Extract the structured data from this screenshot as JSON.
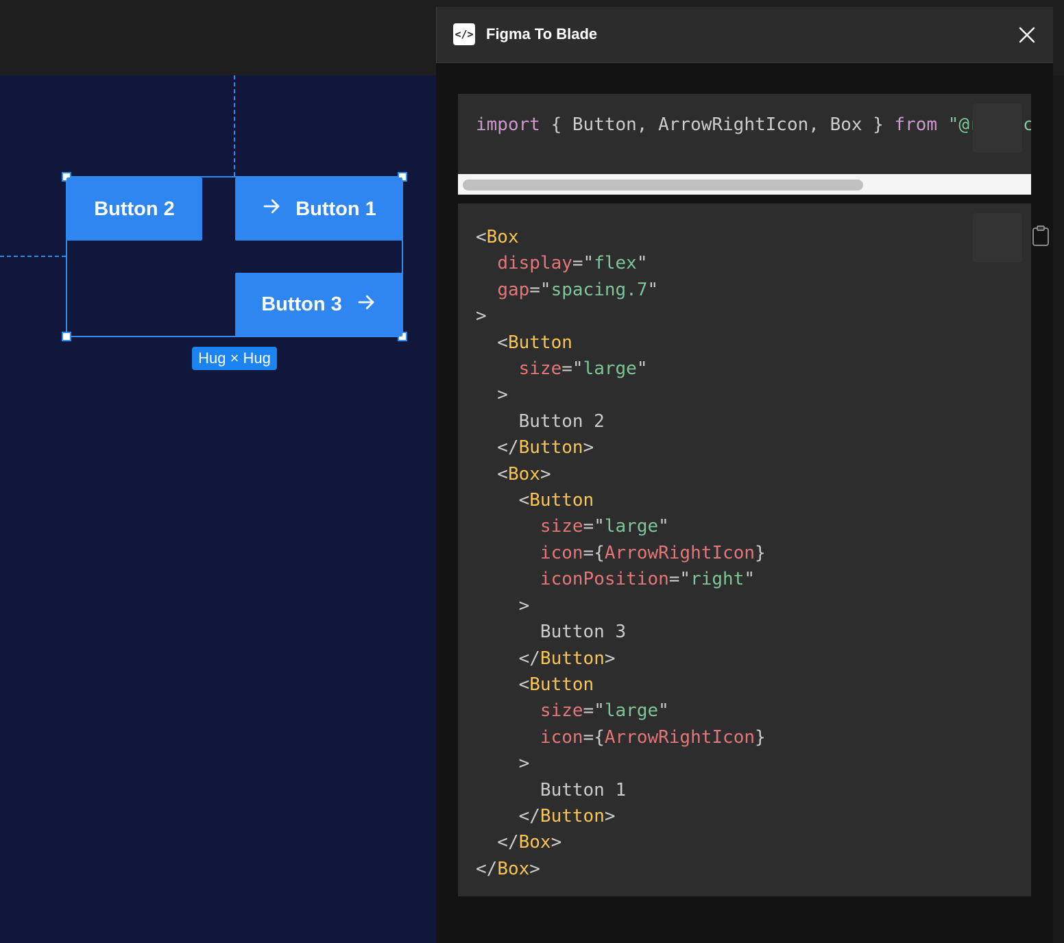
{
  "canvas": {
    "buttons": {
      "button2": {
        "label": "Button 2"
      },
      "button1": {
        "label": "Button 1",
        "icon": "arrow-right-icon"
      },
      "button3": {
        "label": "Button 3",
        "icon": "arrow-right-icon"
      }
    },
    "size_badge": "Hug × Hug",
    "accent_color": "#2f86f0",
    "selection_color": "#2a8df0"
  },
  "plugin": {
    "title": "Figma To Blade",
    "icon": "code-brackets-icon",
    "close_icon": "close-icon"
  },
  "import_code": {
    "kw_import": "import",
    "names": "{ Button, ArrowRightIcon, Box }",
    "kw_from": "from",
    "source": "\"@r",
    "trailing": "c"
  },
  "jsx_code": {
    "lines": [
      [
        {
          "t": "pun",
          "v": "<"
        },
        {
          "t": "tag",
          "v": "Box"
        }
      ],
      [
        {
          "t": "pun",
          "v": "  "
        },
        {
          "t": "attr",
          "v": "display"
        },
        {
          "t": "pun",
          "v": "=\""
        },
        {
          "t": "str",
          "v": "flex"
        },
        {
          "t": "pun",
          "v": "\""
        }
      ],
      [
        {
          "t": "pun",
          "v": "  "
        },
        {
          "t": "attr",
          "v": "gap"
        },
        {
          "t": "pun",
          "v": "=\""
        },
        {
          "t": "str",
          "v": "spacing.7"
        },
        {
          "t": "pun",
          "v": "\""
        }
      ],
      [
        {
          "t": "pun",
          "v": ">"
        }
      ],
      [
        {
          "t": "pun",
          "v": "  <"
        },
        {
          "t": "tag",
          "v": "Button"
        }
      ],
      [
        {
          "t": "pun",
          "v": "    "
        },
        {
          "t": "attr",
          "v": "size"
        },
        {
          "t": "pun",
          "v": "=\""
        },
        {
          "t": "str",
          "v": "large"
        },
        {
          "t": "pun",
          "v": "\""
        }
      ],
      [
        {
          "t": "pun",
          "v": "  >"
        }
      ],
      [
        {
          "t": "txt",
          "v": "    Button 2"
        }
      ],
      [
        {
          "t": "pun",
          "v": "  </"
        },
        {
          "t": "tag",
          "v": "Button"
        },
        {
          "t": "pun",
          "v": ">"
        }
      ],
      [
        {
          "t": "pun",
          "v": "  <"
        },
        {
          "t": "tag",
          "v": "Box"
        },
        {
          "t": "pun",
          "v": ">"
        }
      ],
      [
        {
          "t": "pun",
          "v": "    <"
        },
        {
          "t": "tag",
          "v": "Button"
        }
      ],
      [
        {
          "t": "pun",
          "v": "      "
        },
        {
          "t": "attr",
          "v": "size"
        },
        {
          "t": "pun",
          "v": "=\""
        },
        {
          "t": "str",
          "v": "large"
        },
        {
          "t": "pun",
          "v": "\""
        }
      ],
      [
        {
          "t": "pun",
          "v": "      "
        },
        {
          "t": "attr",
          "v": "icon"
        },
        {
          "t": "pun",
          "v": "={"
        },
        {
          "t": "attr",
          "v": "ArrowRightIcon"
        },
        {
          "t": "pun",
          "v": "}"
        }
      ],
      [
        {
          "t": "pun",
          "v": "      "
        },
        {
          "t": "attr",
          "v": "iconPosition"
        },
        {
          "t": "pun",
          "v": "=\""
        },
        {
          "t": "str",
          "v": "right"
        },
        {
          "t": "pun",
          "v": "\""
        }
      ],
      [
        {
          "t": "pun",
          "v": "    >"
        }
      ],
      [
        {
          "t": "txt",
          "v": "      Button 3"
        }
      ],
      [
        {
          "t": "pun",
          "v": "    </"
        },
        {
          "t": "tag",
          "v": "Button"
        },
        {
          "t": "pun",
          "v": ">"
        }
      ],
      [
        {
          "t": "pun",
          "v": "    <"
        },
        {
          "t": "tag",
          "v": "Button"
        }
      ],
      [
        {
          "t": "pun",
          "v": "      "
        },
        {
          "t": "attr",
          "v": "size"
        },
        {
          "t": "pun",
          "v": "=\""
        },
        {
          "t": "str",
          "v": "large"
        },
        {
          "t": "pun",
          "v": "\""
        }
      ],
      [
        {
          "t": "pun",
          "v": "      "
        },
        {
          "t": "attr",
          "v": "icon"
        },
        {
          "t": "pun",
          "v": "={"
        },
        {
          "t": "attr",
          "v": "ArrowRightIcon"
        },
        {
          "t": "pun",
          "v": "}"
        }
      ],
      [
        {
          "t": "pun",
          "v": "    >"
        }
      ],
      [
        {
          "t": "txt",
          "v": "      Button 1"
        }
      ],
      [
        {
          "t": "pun",
          "v": "    </"
        },
        {
          "t": "tag",
          "v": "Button"
        },
        {
          "t": "pun",
          "v": ">"
        }
      ],
      [
        {
          "t": "pun",
          "v": "  </"
        },
        {
          "t": "tag",
          "v": "Box"
        },
        {
          "t": "pun",
          "v": ">"
        }
      ],
      [
        {
          "t": "pun",
          "v": "</"
        },
        {
          "t": "tag",
          "v": "Box"
        },
        {
          "t": "pun",
          "v": ">"
        }
      ]
    ]
  },
  "copy_icon": "clipboard-icon"
}
